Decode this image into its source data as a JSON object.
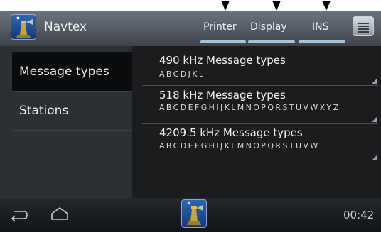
{
  "header": {
    "title": "Navtex",
    "tabs": [
      {
        "label": "Printer"
      },
      {
        "label": "Display"
      },
      {
        "label": "INS"
      }
    ],
    "menu_icon": "menu-list-icon",
    "app_icon": "navtex-lighthouse-icon"
  },
  "sidebar": {
    "items": [
      {
        "label": "Message types",
        "selected": true
      },
      {
        "label": "Stations",
        "selected": false
      }
    ]
  },
  "message_types": [
    {
      "title": "490 kHz Message types",
      "letters": "ABCDJKL"
    },
    {
      "title": "518 kHz Message types",
      "letters": "ABCDEFGHIJKLMNOPQRSTUVWXYZ"
    },
    {
      "title": "4209.5 kHz Message types",
      "letters": "ABCDEFGHIJKLMNOPQRSTUVW"
    }
  ],
  "navbar": {
    "back_icon": "back-icon",
    "home_icon": "home-icon",
    "app_icon": "navtex-lighthouse-icon",
    "time": "00:42"
  },
  "colors": {
    "header_top": "#6b7380",
    "background": "#17191b",
    "tab_indicator": "#a8c4d8",
    "icon_blue": "#2b66b8"
  }
}
